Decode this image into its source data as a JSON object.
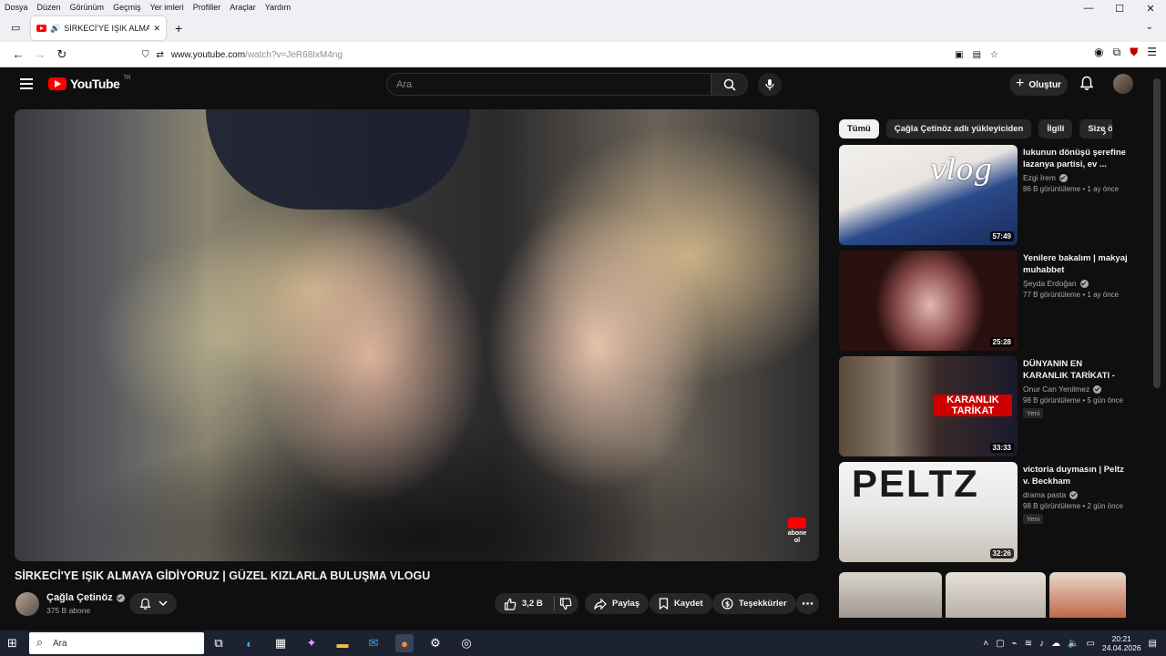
{
  "browser": {
    "menu": [
      "Dosya",
      "Düzen",
      "Görünüm",
      "Geçmiş",
      "Yer imleri",
      "Profiller",
      "Araçlar",
      "Yardım"
    ],
    "tab_title": "SİRKECİ'YE IŞIK ALMAYA Gİ",
    "url_host": "www.youtube.com",
    "url_path": "/watch?v=JeR68IxM4ng"
  },
  "yt": {
    "logo": "YouTube",
    "country": "TR",
    "search_placeholder": "Ara",
    "create_label": "Oluştur"
  },
  "video": {
    "title": "SİRKECİ'YE IŞIK ALMAYA GİDİYORUZ | GÜZEL KIZLARLA BULUŞMA VLOGU",
    "watermark": "abone ol",
    "channel": "Çağla Çetinöz",
    "subscribers": "375 B abone",
    "likes": "3,2 B",
    "share": "Paylaş",
    "save": "Kaydet",
    "thanks": "Teşekkürler"
  },
  "chips": [
    "Tümü",
    "Çağla Çetinöz adlı yükleyiciden",
    "İlgili",
    "Size özel"
  ],
  "recommendations": [
    {
      "title": "lukunun dönüşü şerefine lazanya partisi, ev ...",
      "channel": "Ezgi İrem",
      "meta": "86 B görüntüleme • 1 ay önce",
      "duration": "57:49",
      "badge": "",
      "thumb_text": "vlog"
    },
    {
      "title": "Yenilere bakalım |  makyaj muhabbet",
      "channel": "Şeyda Erdoğan",
      "meta": "77 B görüntüleme • 1 ay önce",
      "duration": "25:28",
      "badge": "",
      "thumb_text": ""
    },
    {
      "title": "DÜNYANIN EN KARANLIK TARİKATI - COLONIA ...",
      "channel": "Onur Can Yenilmez",
      "meta": "98 B görüntüleme • 5 gün önce",
      "duration": "33:33",
      "badge": "Yeni",
      "thumb_text": "KARANLIK TARİKAT"
    },
    {
      "title": "victoria duymasın | Peltz v. Beckham",
      "channel": "drama pasta",
      "meta": "98 B görüntüleme • 2 gün önce",
      "duration": "32:26",
      "badge": "Yeni",
      "thumb_text": "PELTZ"
    }
  ],
  "taskbar": {
    "search_text": "Ara",
    "time": "20:21",
    "date": "24.04.2026"
  },
  "colors": {
    "yt_bg": "#0f0f0f",
    "yt_red": "#ff0000",
    "pill_bg": "#272727",
    "taskbar_bg": "#1c2230"
  }
}
